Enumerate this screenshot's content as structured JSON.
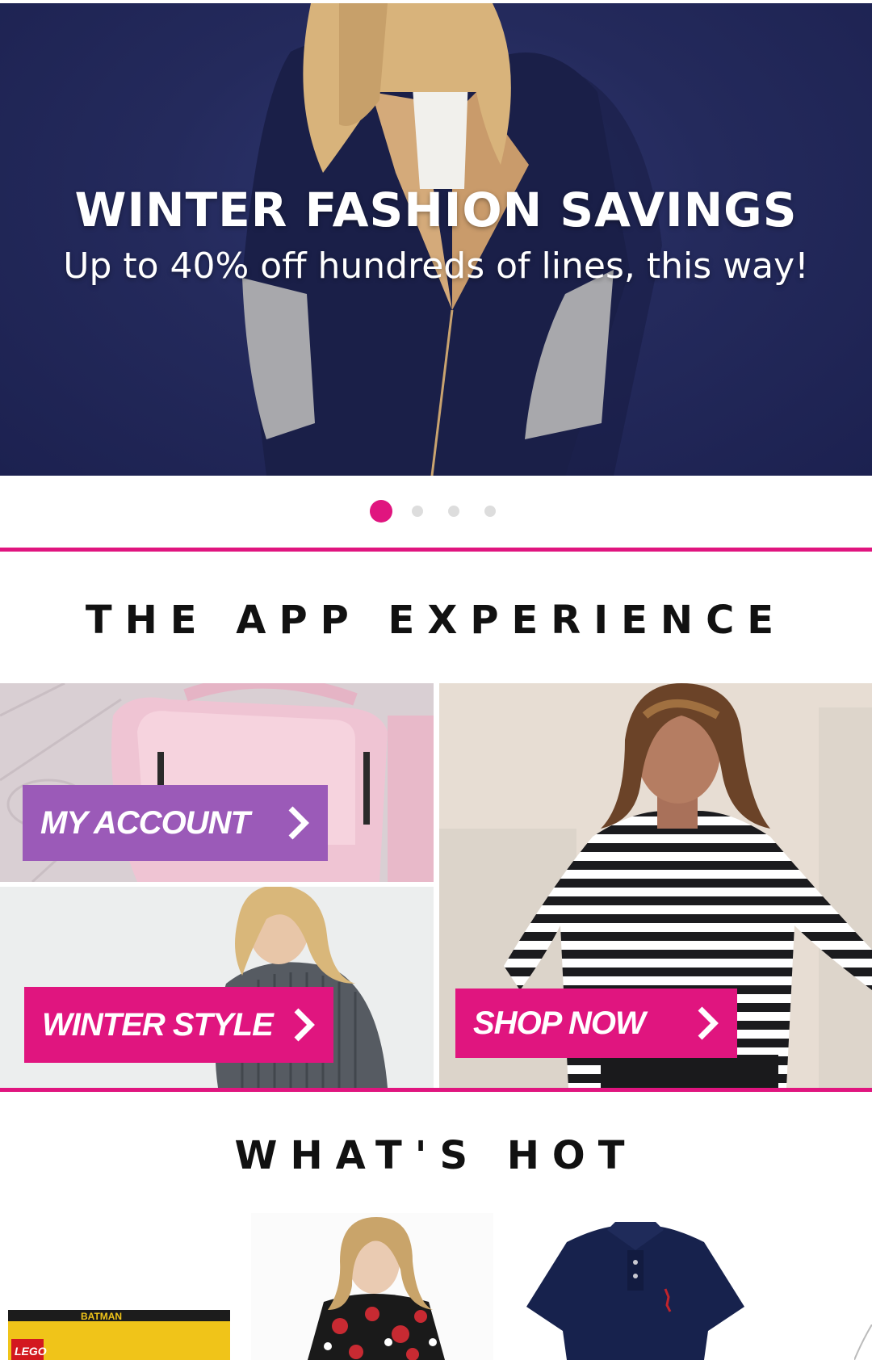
{
  "hero": {
    "title": "WINTER FASHION SAVINGS",
    "subtitle": "Up to 40% off hundreds of lines, this way!",
    "slide_count": 4,
    "active_slide": 1
  },
  "app_experience": {
    "heading": "THE APP EXPERIENCE",
    "tiles": [
      {
        "label": "MY ACCOUNT",
        "color": "#9b5ab8"
      },
      {
        "label": "WINTER STYLE",
        "color": "#e0157f"
      },
      {
        "label": "SHOP NOW",
        "color": "#e0157f"
      }
    ]
  },
  "whats_hot": {
    "heading": "WHAT'S HOT",
    "products": [
      {
        "name": "lego-batman-box",
        "visible_text": "BATMAN",
        "brand_text": "LEGO"
      },
      {
        "name": "floral-dress"
      },
      {
        "name": "navy-polo-shirt"
      }
    ]
  },
  "colors": {
    "accent": "#e0157f",
    "purple": "#9b5ab8",
    "hero_bg": "#242a5c"
  }
}
